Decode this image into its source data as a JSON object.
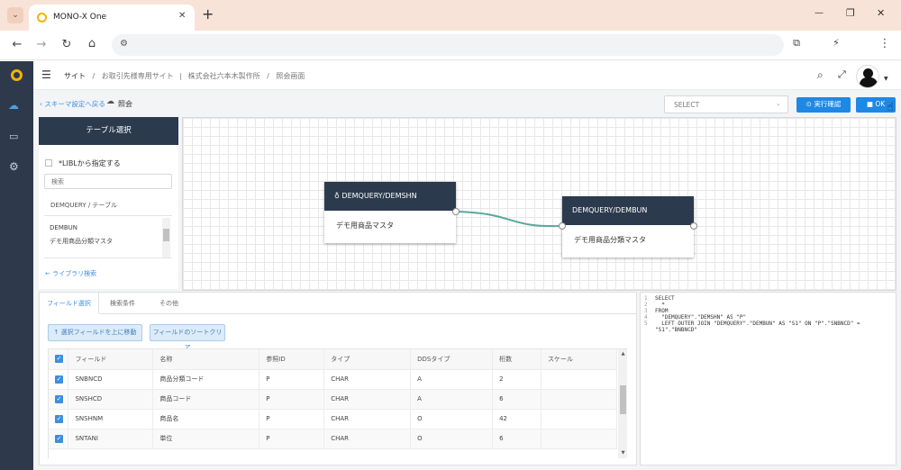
{
  "browser": {
    "tab_title": "MONO-X One",
    "new_tab": "+",
    "window_controls": [
      "—",
      "❐",
      "✕"
    ]
  },
  "app": {
    "breadcrumb": [
      "サイト",
      "お取引先様専用サイト",
      "株式会社六本木製作所",
      "照会画面"
    ],
    "separator": "/",
    "back_link": "スキーマ設定へ戻る",
    "page_label": "照会",
    "select_value": "SELECT",
    "run_button": "実行確認",
    "ok_button": "OK"
  },
  "panel": {
    "header": "テーブル選択",
    "checkbox_label": "*LIBLから指定する",
    "search_placeholder": "検索",
    "section_title": "DEMQUERY / テーブル",
    "items": [
      "DEMBUN",
      "デモ用商品分類マスタ"
    ],
    "library_search": "← ライブラリ検索"
  },
  "nodes": [
    {
      "title": "DEMQUERY/DEMSHN",
      "subtitle": "デモ用商品マスタ"
    },
    {
      "title": "DEMQUERY/DEMBUN",
      "subtitle": "デモ用商品分類マスタ"
    }
  ],
  "tabs": [
    "フィールド選択",
    "検索条件",
    "その他"
  ],
  "actions": {
    "move_up": "選択フィールドを上に移動",
    "clear_sort": "フィールドのソートクリア"
  },
  "table": {
    "columns": [
      "フィールド",
      "名称",
      "参照ID",
      "タイプ",
      "DDSタイプ",
      "桁数",
      "スケール"
    ],
    "rows": [
      [
        "SNBNCD",
        "商品分類コード",
        "P",
        "CHAR",
        "A",
        "2",
        ""
      ],
      [
        "SNSHCD",
        "商品コード",
        "P",
        "CHAR",
        "A",
        "6",
        ""
      ],
      [
        "SNSHNM",
        "商品名",
        "P",
        "CHAR",
        "O",
        "42",
        ""
      ],
      [
        "SNTANI",
        "単位",
        "P",
        "CHAR",
        "O",
        "6",
        ""
      ]
    ]
  },
  "sql": {
    "lines": [
      {
        "n": "1",
        "text": "SELECT"
      },
      {
        "n": "2",
        "text": "  *"
      },
      {
        "n": "3",
        "text": "FROM"
      },
      {
        "n": "4",
        "text": "  \"DEMQUERY\".\"DEMSHN\" AS \"P\""
      },
      {
        "n": "5",
        "text": "  LEFT OUTER JOIN \"DEMQUERY\".\"DEMBUN\" AS \"S1\" ON \"P\".\"SNBNCD\" ="
      },
      {
        "n": "",
        "text": "\"S1\".\"BNBNCD\""
      }
    ]
  },
  "colors": {
    "rail": "#2e3a4c",
    "accent": "#1e88e5",
    "node_header": "#2c3a4e",
    "link": "#5aa89a"
  }
}
